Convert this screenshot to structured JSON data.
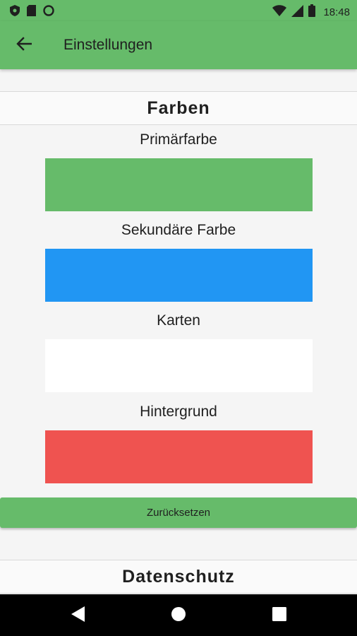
{
  "status_bar": {
    "time": "18:48",
    "left_icons": [
      "shield-icon",
      "sd-card-icon",
      "circle-icon"
    ],
    "right_icons": [
      "wifi-icon",
      "signal-icon",
      "battery-icon"
    ]
  },
  "app_bar": {
    "back_icon": "arrow-back-icon",
    "title": "Einstellungen",
    "background_color": "#66bb6a"
  },
  "sections": {
    "colors": {
      "title": "Farben",
      "items": [
        {
          "label": "Primärfarbe",
          "color": "#66bb6a"
        },
        {
          "label": "Sekundäre Farbe",
          "color": "#2196f3"
        },
        {
          "label": "Karten",
          "color": "#ffffff"
        },
        {
          "label": "Hintergrund",
          "color": "#ef5350"
        }
      ],
      "reset_label": "Zurücksetzen"
    },
    "privacy": {
      "title": "Datenschutz"
    }
  },
  "nav_bar": {
    "buttons": [
      "back-triangle-icon",
      "home-circle-icon",
      "recents-square-icon"
    ]
  }
}
